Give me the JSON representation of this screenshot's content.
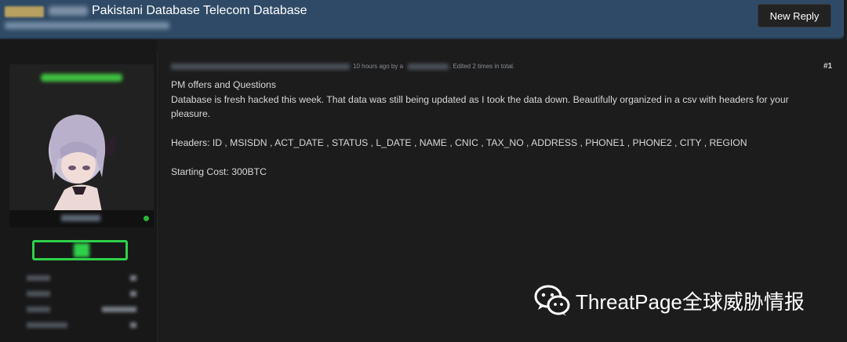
{
  "header": {
    "thread_title": "Pakistani Database Telecom Database",
    "new_reply_label": "New Reply"
  },
  "post": {
    "meta_time": "10 hours ago by a",
    "meta_edit": ". Edited 2 times in total.",
    "number": "#1",
    "lines": [
      "PM offers and Questions",
      "Database is fresh hacked this week. That data was still being updated as I took the data down. Beautifully organized in a csv with headers for your pleasure.",
      "Headers: ID , MSISDN , ACT_DATE , STATUS , L_DATE , NAME , CNIC , TAX_NO , ADDRESS , PHONE1 , PHONE2 , CITY , REGION",
      "Starting Cost: 300BTC"
    ]
  },
  "watermark": {
    "text": "ThreatPage全球威胁情报",
    "icon": "wechat-icon"
  },
  "colors": {
    "header_bg": "#2f4a66",
    "online_green": "#27b832",
    "rank_green": "#2fd14a"
  }
}
